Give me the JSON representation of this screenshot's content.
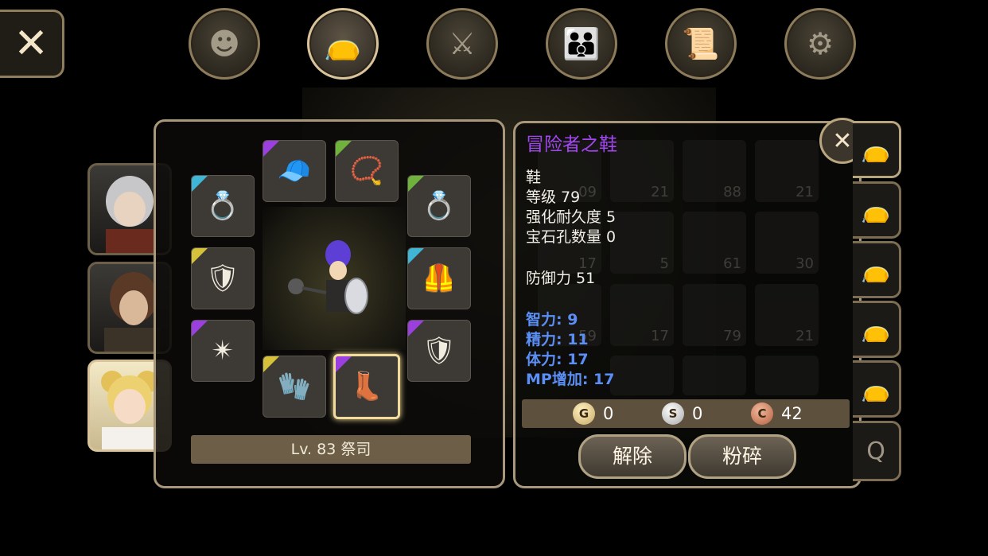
{
  "top_nav": [
    {
      "name": "character-nav-button",
      "icon": "head-icon",
      "glyph": "☻"
    },
    {
      "name": "inventory-nav-button",
      "icon": "bag-icon",
      "glyph": "👝"
    },
    {
      "name": "skills-nav-button",
      "icon": "crossed-swords-icon",
      "glyph": "⚔"
    },
    {
      "name": "party-nav-button",
      "icon": "people-icon",
      "glyph": "👪"
    },
    {
      "name": "quest-nav-button",
      "icon": "scroll-icon",
      "glyph": "📜"
    },
    {
      "name": "settings-nav-button",
      "icon": "gear-icon",
      "glyph": "⚙"
    }
  ],
  "equipment": {
    "level_label": "Lv. 83 祭司",
    "slots": [
      {
        "name": "helmet-slot",
        "rarity_color": "#9b3fe0",
        "icon": "bandana-icon",
        "glyph": "🧢"
      },
      {
        "name": "necklace-slot",
        "rarity_color": "#6fb23c",
        "icon": "necklace-icon",
        "glyph": "📿"
      },
      {
        "name": "ring-left-slot",
        "rarity_color": "#3fb6d6",
        "icon": "ring-icon",
        "glyph": "💍"
      },
      {
        "name": "ring-right-slot",
        "rarity_color": "#6fb23c",
        "icon": "ring-icon",
        "glyph": "💍"
      },
      {
        "name": "shoulder-slot",
        "rarity_color": "#d6c23a",
        "icon": "armor-icon",
        "glyph": "🛡"
      },
      {
        "name": "armor-slot",
        "rarity_color": "#3fb6d6",
        "icon": "vest-icon",
        "glyph": "🦺"
      },
      {
        "name": "weapon-slot",
        "rarity_color": "#9b3fe0",
        "icon": "mace-icon",
        "glyph": "✴"
      },
      {
        "name": "shield-slot",
        "rarity_color": "#9b3fe0",
        "icon": "shield-icon",
        "glyph": "🛡"
      },
      {
        "name": "gloves-slot",
        "rarity_color": "#d6c23a",
        "icon": "gauntlet-icon",
        "glyph": "🧤"
      },
      {
        "name": "boots-slot",
        "rarity_color": "#9b3fe0",
        "icon": "boot-icon",
        "glyph": "👢"
      }
    ]
  },
  "item_detail": {
    "name": "冒险者之鞋",
    "name_color": "#a246f0",
    "type": "鞋",
    "level": "等级 79",
    "durability": "强化耐久度 5",
    "sockets": "宝石孔数量 0",
    "defense": "防御力 51",
    "stats": [
      "智力: 9",
      "精力: 11",
      "体力: 17",
      "MP增加: 17"
    ]
  },
  "bag_background_counts": [
    "09",
    "21",
    "88",
    "21",
    "17",
    "5",
    "61",
    "30",
    "59",
    "17",
    "79",
    "21"
  ],
  "currency": {
    "gold": {
      "letter": "G",
      "value": "0"
    },
    "silver": {
      "letter": "S",
      "value": "0"
    },
    "copper": {
      "letter": "C",
      "value": "42"
    }
  },
  "actions": {
    "unequip": "解除",
    "shatter": "粉碎"
  },
  "bag_tabs": [
    {
      "glyph": "👝"
    },
    {
      "glyph": "👝"
    },
    {
      "glyph": "👝"
    },
    {
      "glyph": "👝"
    },
    {
      "glyph": "👝"
    },
    {
      "glyph": "👝"
    },
    {
      "glyph": "Q"
    }
  ]
}
